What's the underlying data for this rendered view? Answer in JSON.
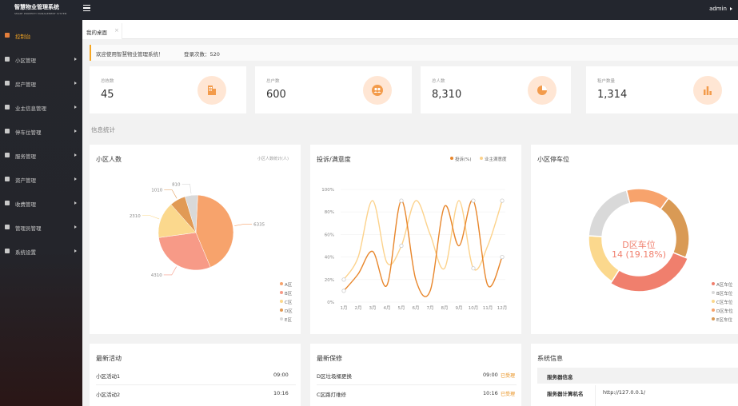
{
  "app": {
    "title": "智慧物业管理系统",
    "subtitle": "SMART PROPERTY MANAGEMENT SYSTEM",
    "user": "admin"
  },
  "sidebar": {
    "items": [
      {
        "label": "控制台",
        "icon": "home-icon",
        "active": true
      },
      {
        "label": "小区管理",
        "icon": "building-icon"
      },
      {
        "label": "房产管理",
        "icon": "house-icon"
      },
      {
        "label": "业主信息管理",
        "icon": "user-group-icon"
      },
      {
        "label": "停车位管理",
        "icon": "car-icon"
      },
      {
        "label": "服务管理",
        "icon": "service-icon"
      },
      {
        "label": "资产管理",
        "icon": "asset-icon"
      },
      {
        "label": "收费管理",
        "icon": "payment-icon"
      },
      {
        "label": "管理员管理",
        "icon": "admin-icon"
      },
      {
        "label": "系统设置",
        "icon": "settings-icon"
      }
    ]
  },
  "tabs": [
    {
      "label": "我的桌面",
      "close": "×"
    }
  ],
  "welcome": {
    "text": "欢迎使用智慧物业管理系统！",
    "login_count": "登录次数：520"
  },
  "stats": [
    {
      "label": "总栋数",
      "value": "45",
      "icon": "building-stat-icon"
    },
    {
      "label": "总户数",
      "value": "600",
      "icon": "people-stat-icon"
    },
    {
      "label": "总人数",
      "value": "8,310",
      "icon": "pie-stat-icon"
    },
    {
      "label": "租户数量",
      "value": "1,314",
      "icon": "bar-stat-icon"
    }
  ],
  "section_title": "信息统计",
  "colors": {
    "accent": "#f5a623",
    "pie": [
      "#f7a36c",
      "#f79a87",
      "#fbd88d",
      "#e19a55",
      "#d9d9d9"
    ],
    "line1": "#e8862b",
    "line2": "#fcd28b"
  },
  "chart_data": [
    {
      "type": "pie",
      "title": "小区人数",
      "subtitle": "小区人数统计(人)",
      "categories": [
        "A区",
        "B区",
        "C区",
        "D区",
        "E区"
      ],
      "values": [
        6335,
        4310,
        2310,
        1010,
        810
      ],
      "value_labels": [
        "6335",
        "4310",
        "2310",
        "1010",
        "810"
      ]
    },
    {
      "type": "line",
      "title": "投诉/满意度",
      "categories": [
        "1月",
        "2月",
        "3月",
        "4月",
        "5月",
        "6月",
        "7月",
        "8月",
        "9月",
        "10月",
        "11月",
        "12月"
      ],
      "yticks": [
        "0%",
        "20%",
        "40%",
        "60%",
        "80%",
        "100%"
      ],
      "ylim": [
        0,
        100
      ],
      "series": [
        {
          "name": "投诉(%)",
          "values": [
            10,
            25,
            45,
            15,
            90,
            20,
            10,
            85,
            50,
            90,
            15,
            40
          ]
        },
        {
          "name": "业主满意度",
          "values": [
            20,
            40,
            90,
            35,
            50,
            90,
            60,
            30,
            90,
            30,
            50,
            90
          ]
        }
      ]
    },
    {
      "type": "pie",
      "title": "小区停车位",
      "center_label": "D区车位",
      "center_value": "14 (19.18%)",
      "categories": [
        "A区车位",
        "B区车位",
        "C区车位",
        "D区车位",
        "E区车位"
      ],
      "values": [
        28,
        20,
        17,
        14,
        21
      ]
    }
  ],
  "activities": {
    "title": "最新活动",
    "rows": [
      {
        "name": "小区活动1",
        "time": "09:00"
      },
      {
        "name": "小区活动2",
        "time": "10:16"
      }
    ]
  },
  "repairs": {
    "title": "最新保修",
    "rows": [
      {
        "name": "D区垃圾桶更换",
        "time": "09:00",
        "status": "已受理"
      },
      {
        "name": "C区路灯维修",
        "time": "10:16",
        "status": "已受理"
      }
    ]
  },
  "system": {
    "title": "系统信息",
    "header": "服务器信息",
    "rows": [
      {
        "key": "服务器计算机名",
        "value": "http://127.0.0.1/"
      }
    ]
  }
}
